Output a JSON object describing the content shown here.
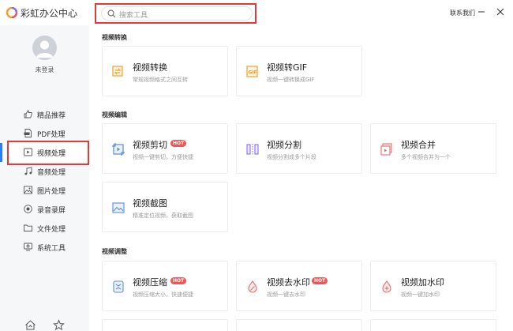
{
  "app": {
    "title": "彩虹办公中心"
  },
  "search": {
    "placeholder": "搜索工具"
  },
  "header": {
    "contact": "联系我们"
  },
  "user": {
    "status": "未登录"
  },
  "sidebar": {
    "items": [
      {
        "label": "精品推荐",
        "icon": "thumbs-up-icon"
      },
      {
        "label": "PDF处理",
        "icon": "pdf-file-icon"
      },
      {
        "label": "视频处理",
        "icon": "video-play-icon",
        "active": true
      },
      {
        "label": "音频处理",
        "icon": "music-note-icon"
      },
      {
        "label": "图片处理",
        "icon": "image-icon"
      },
      {
        "label": "录音录屏",
        "icon": "record-icon"
      },
      {
        "label": "文件处理",
        "icon": "folder-icon"
      },
      {
        "label": "系统工具",
        "icon": "monitor-icon"
      }
    ]
  },
  "colors": {
    "accent": "#2f7cf6",
    "highlight": "#e03a3a",
    "hot": "#f25555",
    "icon_orange": "#f0a030",
    "icon_blue": "#5b8fd6",
    "icon_purple": "#8c6fe6",
    "icon_red": "#ec6d6d"
  },
  "sections": [
    {
      "title": "视频转换",
      "cards": [
        {
          "title": "视频转换",
          "desc": "常规视频格式之间互转",
          "icon": "convert-icon"
        },
        {
          "title": "视频转GIF",
          "desc": "视频一键转换成GIF",
          "icon": "gif-icon"
        }
      ]
    },
    {
      "title": "视频编辑",
      "cards": [
        {
          "title": "视频剪切",
          "desc": "视频一键剪切，方便快捷",
          "icon": "cut-icon",
          "badge": "HOT"
        },
        {
          "title": "视频分割",
          "desc": "视频分割成多个片段",
          "icon": "split-icon"
        },
        {
          "title": "视频合并",
          "desc": "多个视频合并为一个",
          "icon": "merge-icon"
        },
        {
          "title": "视频截图",
          "desc": "精准定位视频，获取截图",
          "icon": "screenshot-icon"
        }
      ]
    },
    {
      "title": "视频调整",
      "cards": [
        {
          "title": "视频压缩",
          "desc": "视频压缩大小，快速便捷",
          "icon": "compress-icon",
          "badge": "HOT"
        },
        {
          "title": "视频去水印",
          "desc": "视频一键去水印",
          "icon": "remove-watermark-icon",
          "badge": "HOT"
        },
        {
          "title": "视频加水印",
          "desc": "视频一键加水印",
          "icon": "add-watermark-icon"
        }
      ]
    }
  ]
}
